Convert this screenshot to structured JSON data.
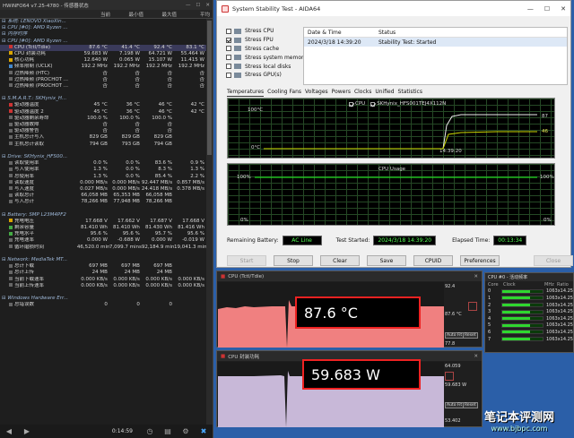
{
  "hwinfo": {
    "title": "HWiNFO64 v7.25-4780 - 传感器状态",
    "columns": [
      "",
      "当前",
      "最小值",
      "最大值",
      "平均"
    ],
    "rows": [
      {
        "type": "group",
        "label": "系统: LENOVO XiaoXin..."
      },
      {
        "type": "group",
        "label": "CPU [#0]: AMD Ryzen ..."
      },
      {
        "type": "group",
        "label": "内存时序"
      },
      {
        "type": "group",
        "label": "CPU [#0]: AMD Ryzen ..."
      },
      {
        "type": "row",
        "label": "CPU (Tctl/Tdie)",
        "dot": "r",
        "v": [
          "87.6 °C",
          "41.4 °C",
          "92.4 °C",
          "83.1 °C"
        ],
        "sel": true
      },
      {
        "type": "row",
        "label": "CPU 封装功耗",
        "dot": "y",
        "v": [
          "59.683 W",
          "7.198 W",
          "64.721 W",
          "55.464 W"
        ]
      },
      {
        "type": "row",
        "label": "核心功耗",
        "dot": "y",
        "v": [
          "12.640 W",
          "0.065 W",
          "15.107 W",
          "11.415 W"
        ]
      },
      {
        "type": "row",
        "label": "频率限制 (UCLK)",
        "dot": "b",
        "v": [
          "192.2 MHz",
          "192.2 MHz",
          "192.2 MHz",
          "192.2 MHz"
        ]
      },
      {
        "type": "row",
        "label": "过热降频 (HTC)",
        "dot": "",
        "v": [
          "否",
          "否",
          "否",
          "否"
        ]
      },
      {
        "type": "row",
        "label": "过热降频 (PROCHOT ...",
        "dot": "",
        "v": [
          "否",
          "否",
          "否",
          "否"
        ]
      },
      {
        "type": "row",
        "label": "过热降频 (PROCHOT ...",
        "dot": "",
        "v": [
          "否",
          "否",
          "否",
          "否"
        ]
      },
      {
        "type": "blank"
      },
      {
        "type": "group",
        "label": "S.M.A.R.T.: SKHynix_H..."
      },
      {
        "type": "row",
        "label": "驱动器温度",
        "dot": "r",
        "v": [
          "45 °C",
          "36 °C",
          "46 °C",
          "42 °C"
        ]
      },
      {
        "type": "row",
        "label": "驱动器温度 2",
        "dot": "r",
        "v": [
          "45 °C",
          "36 °C",
          "46 °C",
          "42 °C"
        ]
      },
      {
        "type": "row",
        "label": "驱动器剩余寿命",
        "dot": "",
        "v": [
          "100.0 %",
          "100.0 %",
          "100.0 %",
          ""
        ]
      },
      {
        "type": "row",
        "label": "驱动器故障",
        "dot": "",
        "v": [
          "否",
          "否",
          "否",
          ""
        ]
      },
      {
        "type": "row",
        "label": "驱动器警告",
        "dot": "",
        "v": [
          "否",
          "否",
          "否",
          ""
        ]
      },
      {
        "type": "row",
        "label": "主机总计写入",
        "dot": "",
        "v": [
          "829 GB",
          "829 GB",
          "829 GB",
          ""
        ]
      },
      {
        "type": "row",
        "label": "主机总计读取",
        "dot": "",
        "v": [
          "794 GB",
          "793 GB",
          "794 GB",
          ""
        ]
      },
      {
        "type": "blank"
      },
      {
        "type": "group",
        "label": "Drive: SKHynix_HFS00..."
      },
      {
        "type": "row",
        "label": "读取使用率",
        "dot": "",
        "v": [
          "0.0 %",
          "0.0 %",
          "83.6 %",
          "0.9 %"
        ]
      },
      {
        "type": "row",
        "label": "写入使用率",
        "dot": "",
        "v": [
          "1.3 %",
          "0.0 %",
          "8.3 %",
          "1.3 %"
        ]
      },
      {
        "type": "row",
        "label": "总使用率",
        "dot": "",
        "v": [
          "1.3 %",
          "0.0 %",
          "85.4 %",
          "2.2 %"
        ]
      },
      {
        "type": "row",
        "label": "读取速度",
        "dot": "",
        "v": [
          "0.000 MB/s",
          "0.000 MB/s",
          "92.447 MB/s",
          "0.857 MB/s"
        ]
      },
      {
        "type": "row",
        "label": "写入速度",
        "dot": "",
        "v": [
          "0.027 MB/s",
          "0.000 MB/s",
          "24.418 MB/s",
          "0.378 MB/s"
        ]
      },
      {
        "type": "row",
        "label": "读取总计",
        "dot": "",
        "v": [
          "66,058 MB",
          "65,353 MB",
          "66,058 MB",
          ""
        ]
      },
      {
        "type": "row",
        "label": "写入总计",
        "dot": "",
        "v": [
          "78,266 MB",
          "77,948 MB",
          "78,266 MB",
          ""
        ]
      },
      {
        "type": "blank"
      },
      {
        "type": "group",
        "label": "Battery: SMP L23M4PF2"
      },
      {
        "type": "row",
        "label": "充电电压",
        "dot": "y",
        "v": [
          "17.668 V",
          "17.662 V",
          "17.687 V",
          "17.668 V"
        ]
      },
      {
        "type": "row",
        "label": "剩余容量",
        "dot": "g",
        "v": [
          "81.410 Wh",
          "81.410 Wh",
          "81.430 Wh",
          "81.416 Wh"
        ]
      },
      {
        "type": "row",
        "label": "充电水平",
        "dot": "g",
        "v": [
          "95.6 %",
          "95.6 %",
          "95.7 %",
          "95.6 %"
        ]
      },
      {
        "type": "row",
        "label": "充电速率",
        "dot": "",
        "v": [
          "0.000 W",
          "-0.688 W",
          "0.000 W",
          "-0.019 W"
        ]
      },
      {
        "type": "row",
        "label": "循环磨损时间",
        "dot": "",
        "v": [
          "46,520.0 mins",
          "7,099.7 mins",
          "92,184.9 mins",
          "19,041.3 mins"
        ]
      },
      {
        "type": "blank"
      },
      {
        "type": "group",
        "label": "Network: MediaTek MT..."
      },
      {
        "type": "row",
        "label": "总计下载",
        "dot": "",
        "v": [
          "697 MB",
          "697 MB",
          "697 MB",
          ""
        ]
      },
      {
        "type": "row",
        "label": "总计上传",
        "dot": "",
        "v": [
          "24 MB",
          "24 MB",
          "24 MB",
          ""
        ]
      },
      {
        "type": "row",
        "label": "当前下载速率",
        "dot": "",
        "v": [
          "0.000 KB/s",
          "0.000 KB/s",
          "0.000 KB/s",
          "0.000 KB/s"
        ]
      },
      {
        "type": "row",
        "label": "当前上传速率",
        "dot": "",
        "v": [
          "0.000 KB/s",
          "0.000 KB/s",
          "0.000 KB/s",
          "0.000 KB/s"
        ]
      },
      {
        "type": "blank"
      },
      {
        "type": "group",
        "label": "Windows Hardware Err..."
      },
      {
        "type": "row",
        "label": "总错误数",
        "dot": "",
        "v": [
          "0",
          "0",
          "0",
          ""
        ]
      }
    ],
    "footer_time": "0:14:59"
  },
  "aida": {
    "title": "System Stability Test - AIDA64",
    "stress_items": [
      {
        "label": "Stress CPU",
        "checked": false
      },
      {
        "label": "Stress FPU",
        "checked": true
      },
      {
        "label": "Stress cache",
        "checked": false
      },
      {
        "label": "Stress system memory",
        "checked": false
      },
      {
        "label": "Stress local disks",
        "checked": false
      },
      {
        "label": "Stress GPU(s)",
        "checked": false
      }
    ],
    "status_headers": [
      "Date & Time",
      "Status"
    ],
    "status_row": [
      "2024/3/18 14:39:20",
      "Stability Test: Started"
    ],
    "tabs": [
      "Temperatures",
      "Cooling Fans",
      "Voltages",
      "Powers",
      "Clocks",
      "Unified",
      "Statistics"
    ],
    "temp_graph": {
      "legend": [
        "CPU",
        "SKHynix_HFS001TEJ4X112N"
      ],
      "y_top": "100°C",
      "y_bot": "0°C",
      "time_label": "14:39:20",
      "val1": "87",
      "val2": "46"
    },
    "usage_graph": {
      "title": "CPU Usage",
      "y_top": "100%",
      "y_bot": "0%",
      "right_top": "100%",
      "right_bot": "0%"
    },
    "remaining_battery_label": "Remaining Battery:",
    "remaining_battery_value": "AC Line",
    "test_started_label": "Test Started:",
    "test_started_value": "2024/3/18 14:39:20",
    "elapsed_label": "Elapsed Time:",
    "elapsed_value": "00:13:34",
    "buttons": [
      "Start",
      "Stop",
      "Clear",
      "Save",
      "CPUID",
      "Preferences",
      "Close"
    ]
  },
  "sensor1": {
    "title": "CPU (Tctl/Tdie)",
    "value": "87.6 °C",
    "max": "92.4",
    "cur": "87.6 °C",
    "min": "77.8",
    "btn_auto": "Auto Fit",
    "btn_reset": "Reset",
    "fill_color": "#f08080"
  },
  "sensor2": {
    "title": "CPU 封装功耗",
    "value": "59.683 W",
    "max": "64.059",
    "cur": "59.683 W",
    "min": "53.402",
    "btn_auto": "Auto Fit",
    "btn_reset": "Reset",
    "fill_color": "#c8b8d8"
  },
  "cores": {
    "title": "CPU #0 - 活动频率",
    "header": [
      "Core",
      "Clock",
      "MHz",
      "Ratio"
    ],
    "rows": [
      {
        "id": "0",
        "mhz": "1063",
        "ratio": "x14.25"
      },
      {
        "id": "1",
        "mhz": "1063",
        "ratio": "x14.25"
      },
      {
        "id": "2",
        "mhz": "1063",
        "ratio": "x14.25"
      },
      {
        "id": "3",
        "mhz": "1063",
        "ratio": "x14.25"
      },
      {
        "id": "4",
        "mhz": "1063",
        "ratio": "x14.25"
      },
      {
        "id": "5",
        "mhz": "1063",
        "ratio": "x14.25"
      },
      {
        "id": "6",
        "mhz": "1063",
        "ratio": "x14.25"
      },
      {
        "id": "7",
        "mhz": "1063",
        "ratio": "x14.25"
      }
    ]
  },
  "watermark": {
    "cn": "笔记本评测网",
    "url": "www.bjbpc.com"
  }
}
